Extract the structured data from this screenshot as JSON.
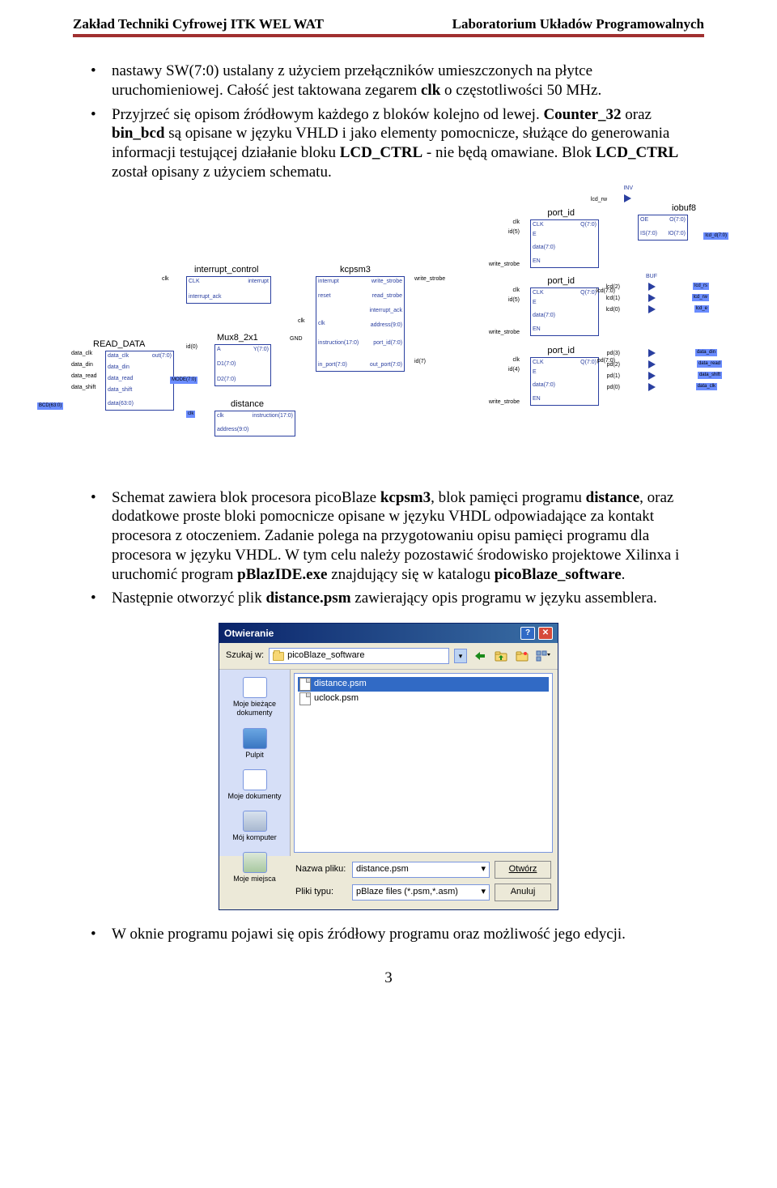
{
  "header": {
    "left": "Zakład Techniki Cyfrowej ITK WEL WAT",
    "right": "Laboratorium Układów Programowalnych"
  },
  "para1": {
    "l1_pre": "nastawy SW(7:0) ustalany z użyciem przełączników umieszczonych na płytce uruchomieniowej. Całość jest taktowana zegarem ",
    "l1_bold1": "clk",
    "l1_mid": " o częstotliwości 50 MHz."
  },
  "para2": {
    "pre": "Przyjrzeć się opisom źródłowym każdego z bloków kolejno od lewej. ",
    "b1": "Counter_32",
    "mid1": " oraz ",
    "b2": "bin_bcd",
    "mid2": " są opisane w języku VHLD i jako elementy pomocnicze, służące do generowania informacji testującej działanie bloku ",
    "b3": "LCD_CTRL",
    "mid3": " - nie będą omawiane. Blok ",
    "b4": "LCD_CTRL",
    "mid4": " został opisany z użyciem schematu."
  },
  "schematic": {
    "blocks": {
      "read_data": "READ_DATA",
      "interrupt_control": "interrupt_control",
      "mux": "Mux8_2x1",
      "kcpsm3": "kcpsm3",
      "port_id": "port_id",
      "distance": "distance",
      "iobuf8": "iobuf8"
    },
    "pins": {
      "clk": "clk",
      "id": "id",
      "id0": "id(0)",
      "id4": "id(4)",
      "id5": "id(5)",
      "id7": "id(7)",
      "data_clk": "data_clk",
      "data_din": "data_din",
      "data_read": "data_read",
      "data_shift": "data_shift",
      "out70": "out(7:0)",
      "data70": "data(7:0)",
      "data630": "data(63:0)",
      "interrupt": "interrupt",
      "interrupt_ack": "interrupt_ack",
      "reset": "reset",
      "write_strobe": "write_strobe",
      "read_strobe": "read_strobe",
      "in_port70": "in_port(7:0)",
      "out_port70": "out_port(7:0)",
      "port_id70": "port_id(7:0)",
      "instruction170": "instruction(17:0)",
      "address90": "address(9:0)",
      "A": "A",
      "Y70": "Y(7:0)",
      "D170": "D1(7:0)",
      "D270": "D2(7:0)",
      "Q70": "Q(7:0)",
      "E": "E",
      "CLK": "CLK",
      "EN": "EN",
      "OE": "OE",
      "O70": "O(7:0)",
      "IO70": "IO(7:0)",
      "IS70": "IS(7:0)",
      "lcd0": "lcd(0)",
      "lcd1": "lcd(1)",
      "lcd2": "lcd(2)",
      "lcd70": "lcd(7:0)",
      "pd0": "pd(0)",
      "pd1": "pd(1)",
      "pd2": "pd(2)",
      "pd3": "pd(3)",
      "pd70": "pd(7:0)",
      "GND": "GND",
      "BUF": "BUF",
      "INV": "INV"
    },
    "nets": {
      "lcd_rw": "lcd_rw",
      "lcd_rs": "lcd_rs",
      "lcd_e": "lcd_e",
      "lcd_d70": "lcd_d(7:0)",
      "data_din": "data_din",
      "data_read": "data_read",
      "data_shift": "data_shift",
      "data_clk": "data_clk",
      "MODE70": "MODE(7:0)",
      "BCD630": "BCD(63:0)"
    }
  },
  "para3": {
    "pre": "Schemat zawiera blok procesora picoBlaze ",
    "b1": "kcpsm3",
    "mid1": ", blok pamięci programu ",
    "b2": "distance",
    "mid2": ", oraz dodatkowe proste bloki pomocnicze opisane w języku VHDL odpowiadające za kontakt procesora z otoczeniem. Zadanie polega na przygotowaniu opisu pamięci programu dla procesora w języku VHDL. W tym celu należy pozostawić środowisko projektowe Xilinxa i uruchomić program ",
    "b3": "pBlazIDE.exe",
    "mid3": " znajdujący się w katalogu ",
    "b4": "picoBlaze_software",
    "mid4": "."
  },
  "para4": {
    "pre": "Następnie otworzyć plik ",
    "b1": "distance.psm",
    "post": " zawierający opis programu w języku assemblera."
  },
  "dialog": {
    "title": "Otwieranie",
    "lookin": "Szukaj w:",
    "folder": "picoBlaze_software",
    "files": [
      "distance.psm",
      "uclock.psm"
    ],
    "side": {
      "recent": "Moje bieżące dokumenty",
      "desktop": "Pulpit",
      "mydocs": "Moje dokumenty",
      "mycomp": "Mój komputer",
      "netplaces": "Moje miejsca"
    },
    "filename_label": "Nazwa pliku:",
    "filename_value": "distance.psm",
    "filetype_label": "Pliki typu:",
    "filetype_value": "pBlaze files (*.psm,*.asm)",
    "open_btn": "Otwórz",
    "cancel_btn": "Anuluj"
  },
  "para5": "W oknie programu pojawi się opis źródłowy programu oraz możliwość jego edycji.",
  "page_number": "3"
}
